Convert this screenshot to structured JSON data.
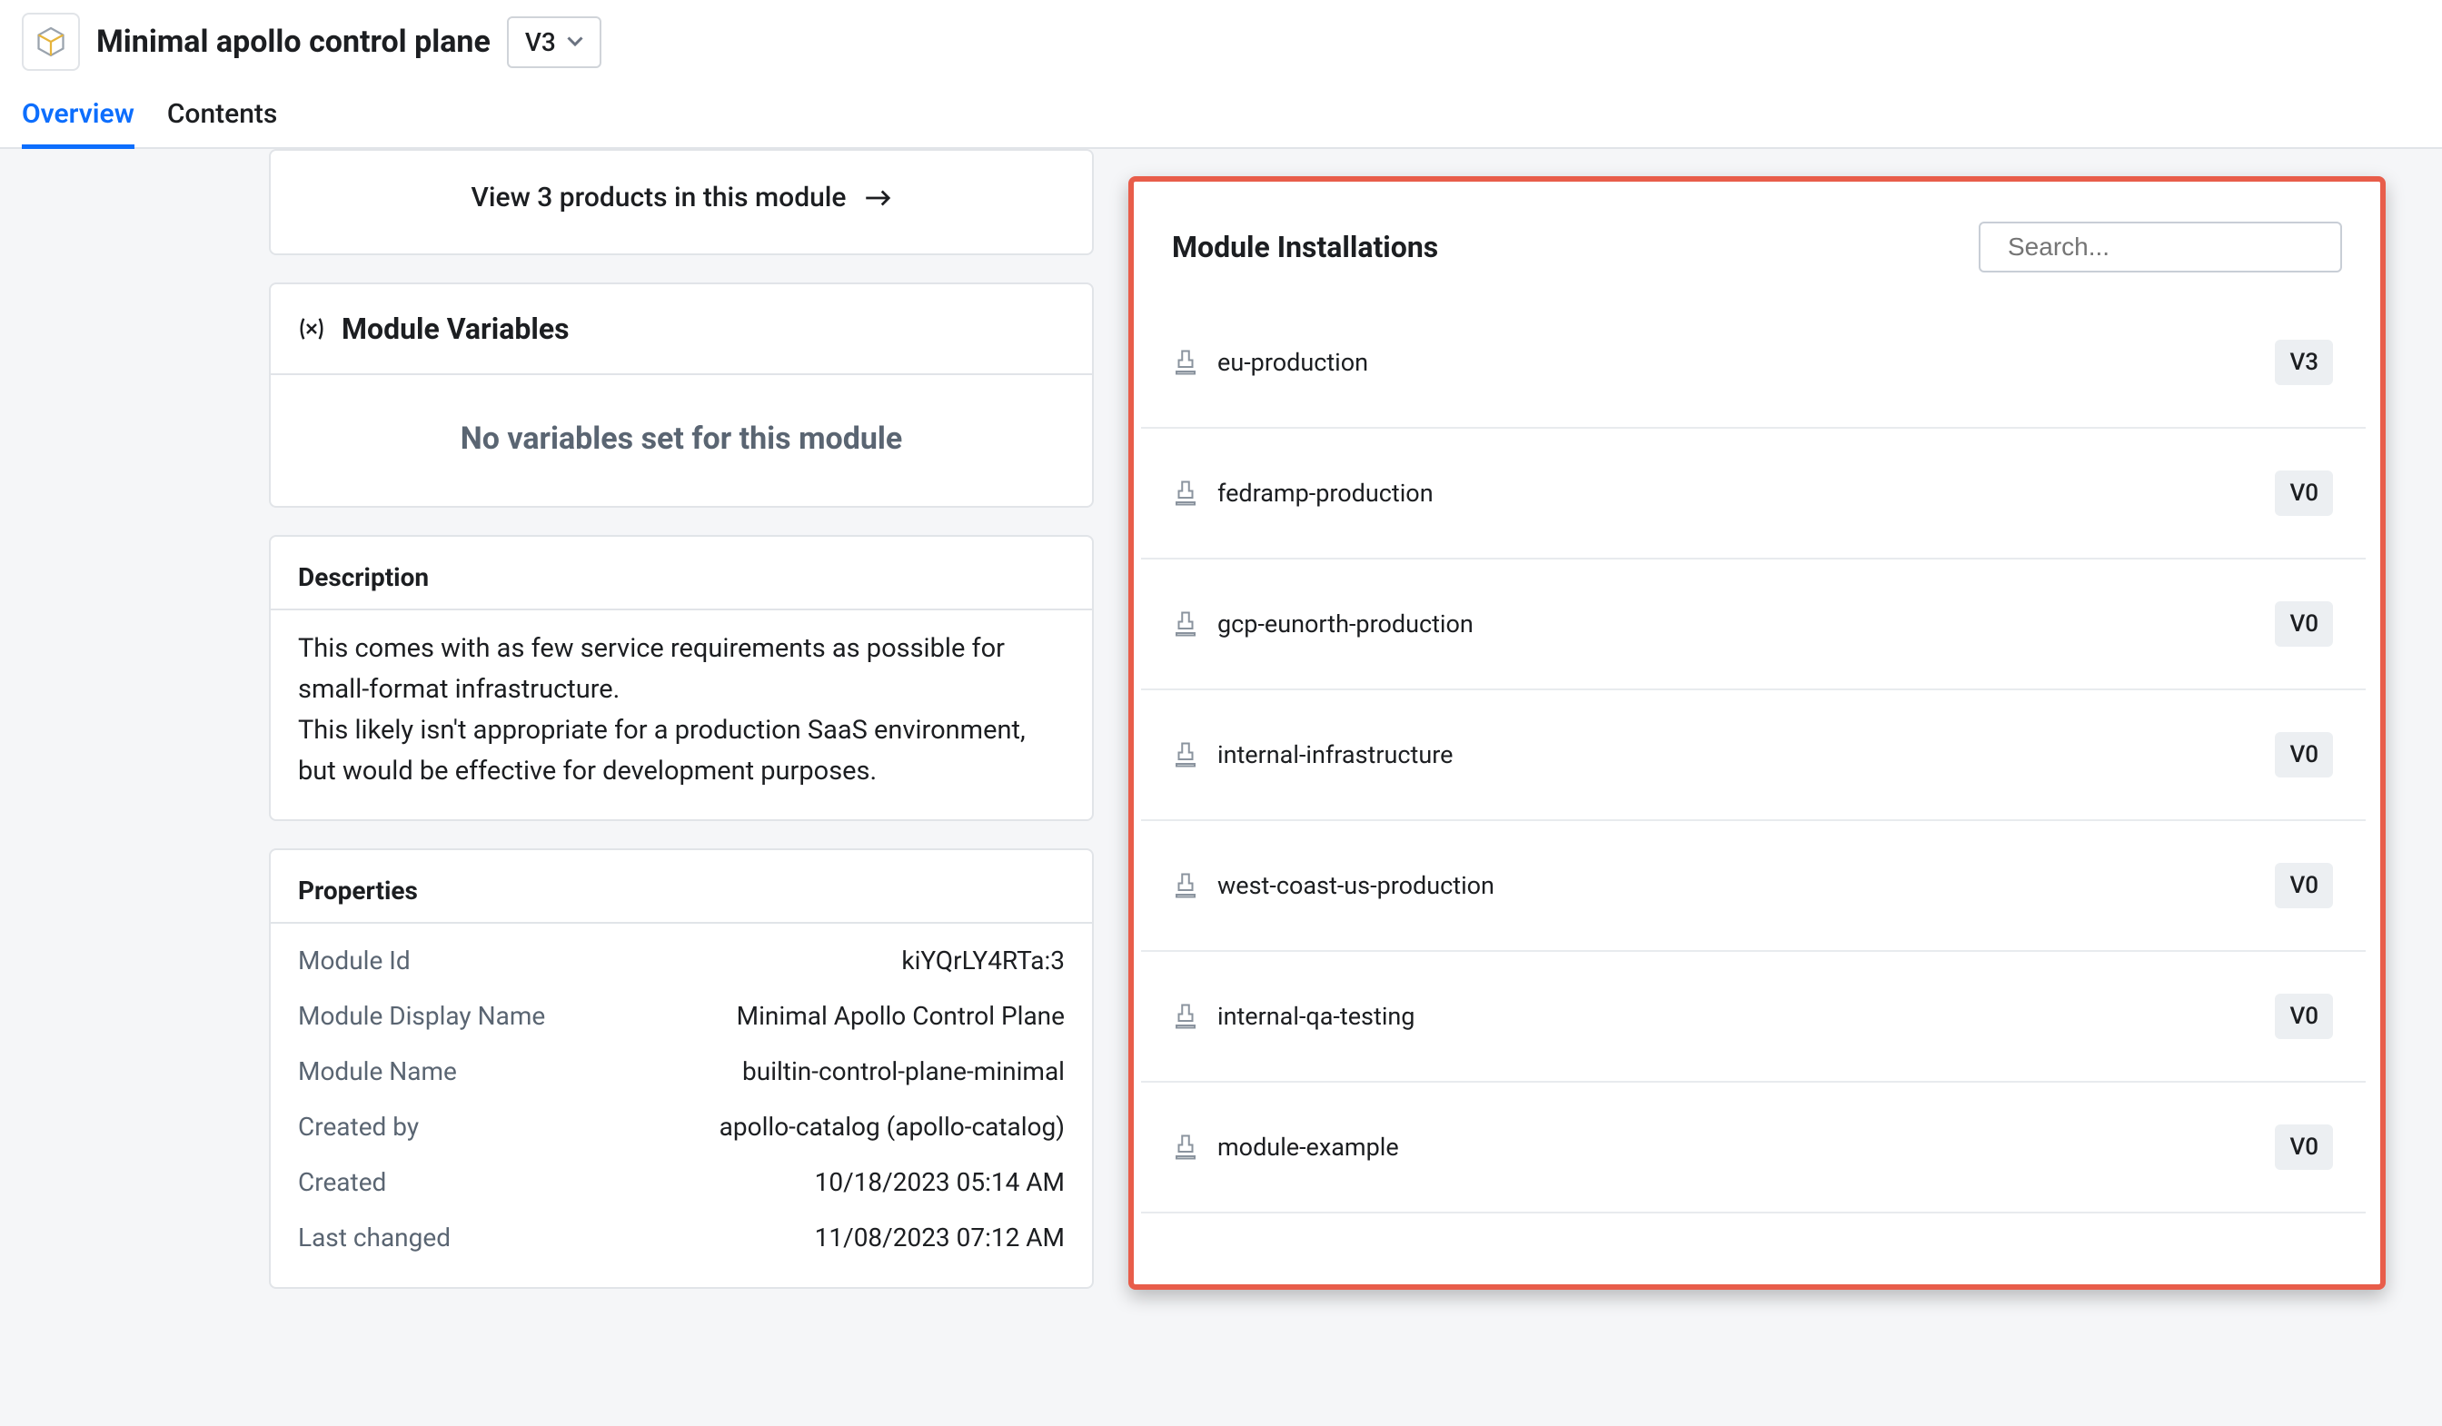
{
  "header": {
    "title": "Minimal apollo control plane",
    "version": "V3"
  },
  "tabs": [
    {
      "label": "Overview",
      "active": true
    },
    {
      "label": "Contents",
      "active": false
    }
  ],
  "banner": {
    "text": "View 3 products in this module"
  },
  "variables": {
    "title": "Module Variables",
    "empty": "No variables set for this module"
  },
  "description": {
    "title": "Description",
    "line1": "This comes with as few service requirements as possible for small-format infrastructure.",
    "line2": "This likely isn't appropriate for a production SaaS environment, but would be effective for development purposes."
  },
  "properties": {
    "title": "Properties",
    "rows": [
      {
        "key": "Module Id",
        "val": "kiYQrLY4RTa:3"
      },
      {
        "key": "Module Display Name",
        "val": "Minimal Apollo Control Plane"
      },
      {
        "key": "Module Name",
        "val": "builtin-control-plane-minimal"
      },
      {
        "key": "Created by",
        "val": "apollo-catalog (apollo-catalog)"
      },
      {
        "key": "Created",
        "val": "10/18/2023 05:14 AM"
      },
      {
        "key": "Last changed",
        "val": "11/08/2023 07:12 AM"
      }
    ]
  },
  "installations": {
    "title": "Module Installations",
    "search_placeholder": "Search...",
    "items": [
      {
        "name": "eu-production",
        "version": "V3"
      },
      {
        "name": "fedramp-production",
        "version": "V0"
      },
      {
        "name": "gcp-eunorth-production",
        "version": "V0"
      },
      {
        "name": "internal-infrastructure",
        "version": "V0"
      },
      {
        "name": "west-coast-us-production",
        "version": "V0"
      },
      {
        "name": "internal-qa-testing",
        "version": "V0"
      },
      {
        "name": "module-example",
        "version": "V0"
      }
    ]
  }
}
